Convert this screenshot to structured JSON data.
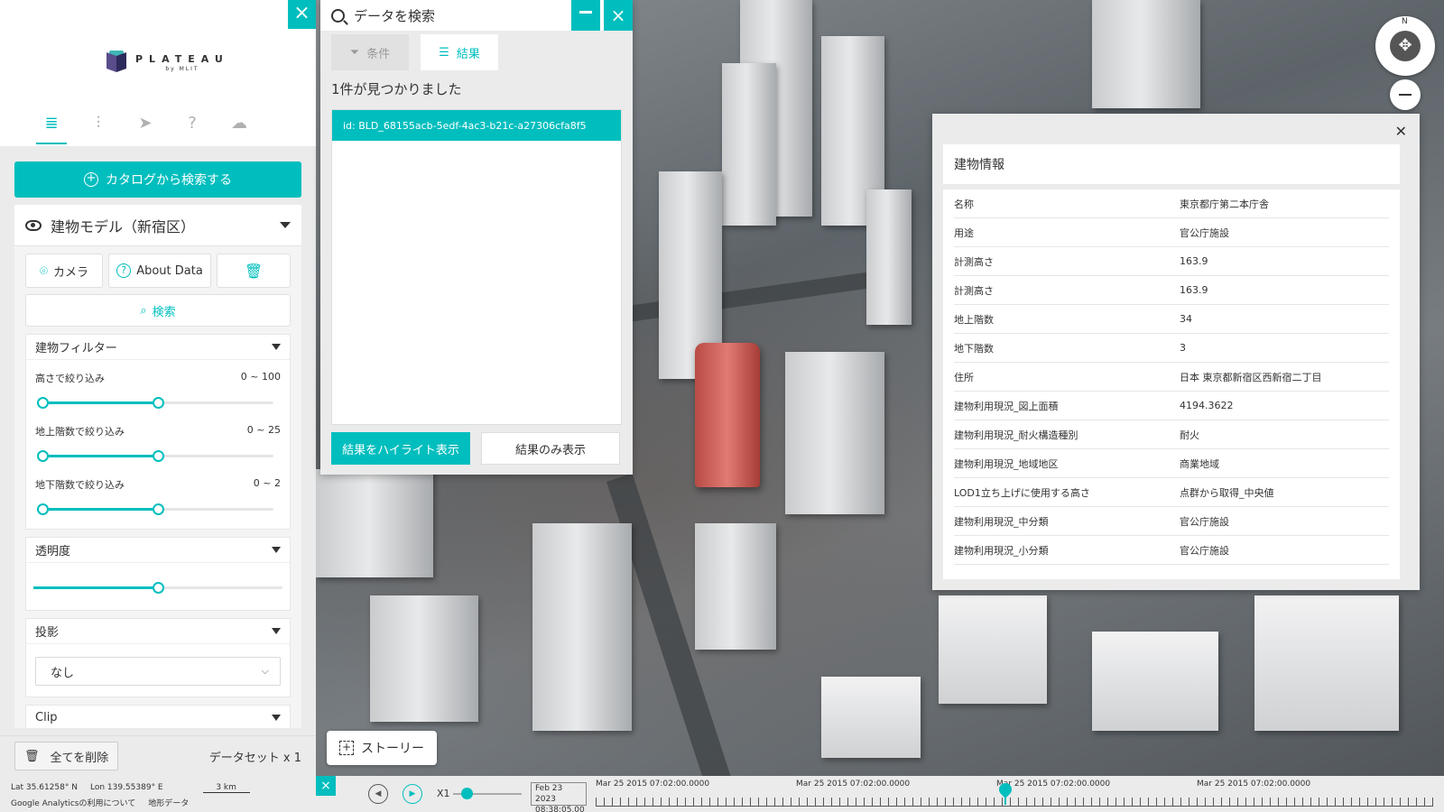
{
  "left_panel": {
    "brand": "PLATEAU",
    "brand_sub": "by MLIT",
    "close_icon": "×",
    "tabs": [
      {
        "name": "database",
        "icon": "≣"
      },
      {
        "name": "sliders",
        "icon": "⫶"
      },
      {
        "name": "share",
        "icon": "➤"
      },
      {
        "name": "help",
        "icon": "?"
      },
      {
        "name": "chat",
        "icon": "☁"
      }
    ],
    "catalog_button": "カタログから検索する",
    "layer": {
      "title": "建物モデル（新宿区）",
      "buttons": {
        "camera": "カメラ",
        "about": "About Data"
      },
      "search_label": "検索",
      "building_filter": {
        "title": "建物フィルター",
        "sliders": [
          {
            "label": "高さで絞り込み",
            "value": "0 ~ 100",
            "min_frac": 0.0,
            "max_frac": 0.5
          },
          {
            "label": "地上階数で絞り込み",
            "value": "0 ~ 25",
            "min_frac": 0.0,
            "max_frac": 0.5
          },
          {
            "label": "地下階数で絞り込み",
            "value": "0 ~ 2",
            "min_frac": 0.0,
            "max_frac": 0.5
          }
        ]
      },
      "transparency": {
        "title": "透明度",
        "value_frac": 0.5
      },
      "shadow": {
        "title": "投影",
        "selected": "なし"
      },
      "clip": {
        "title": "Clip"
      }
    },
    "footer": {
      "delete_all": "全てを削除",
      "dataset_count": "データセット x 1"
    },
    "status": {
      "lat": "Lat  35.61258° N",
      "lon": "Lon  139.55389° E",
      "scale": "3 km",
      "analytics": "Google Analyticsの利用について",
      "terrain": "地形データ"
    }
  },
  "search_panel": {
    "title": "データを検索",
    "tabs": {
      "conditions": "条件",
      "results": "結果"
    },
    "result_count": "1件が見つかりました",
    "results": [
      "id: BLD_68155acb-5edf-4ac3-b21c-a27306cfa8f5"
    ],
    "highlight_button": "結果をハイライト表示",
    "only_button": "結果のみ表示"
  },
  "info_panel": {
    "title": "建物情報",
    "rows": [
      {
        "key": "名称",
        "value": "東京都庁第二本庁舎"
      },
      {
        "key": "用途",
        "value": "官公庁施設"
      },
      {
        "key": "計測高さ",
        "value": "163.9"
      },
      {
        "key": "計測高さ",
        "value": "163.9"
      },
      {
        "key": "地上階数",
        "value": "34"
      },
      {
        "key": "地下階数",
        "value": "3"
      },
      {
        "key": "住所",
        "value": "日本 東京都新宿区西新宿二丁目"
      },
      {
        "key": "建物利用現況_図上面積",
        "value": "4194.3622"
      },
      {
        "key": "建物利用現況_耐火構造種別",
        "value": "耐火"
      },
      {
        "key": "建物利用現況_地域地区",
        "value": "商業地域"
      },
      {
        "key": "LOD1立ち上げに使用する高さ",
        "value": "点群から取得_中央値"
      },
      {
        "key": "建物利用現況_中分類",
        "value": "官公庁施設"
      },
      {
        "key": "建物利用現況_小分類",
        "value": "官公庁施設"
      }
    ]
  },
  "compass": {
    "north": "N"
  },
  "story_button": "ストーリー",
  "timeline": {
    "speed": "X1",
    "speed_frac": 0.2,
    "current_date": "Feb 23 2023",
    "current_time": "08:38:05.00",
    "labels": [
      "Mar 25 2015 07:02:00.0000",
      "Mar 25 2015 07:02:00.0000",
      "Mar 25 2015 07:02:00.0000",
      "Mar 25 2015 07:02:00.0000"
    ]
  },
  "colors": {
    "accent": "#00bebe",
    "selected_building": "#d9645c"
  }
}
